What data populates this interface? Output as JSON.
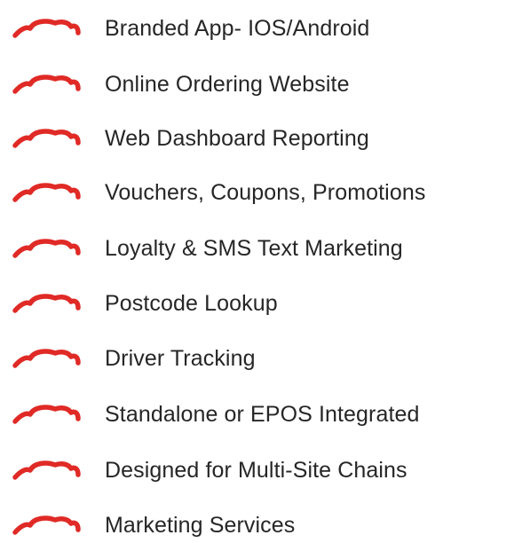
{
  "accent_color": "#e02a26",
  "text_color": "#262626",
  "icon": "red-swoosh-icon",
  "features": [
    "Branded App- IOS/Android",
    "Online Ordering Website",
    "Web Dashboard Reporting",
    "Vouchers, Coupons, Promotions",
    "Loyalty & SMS Text Marketing",
    "Postcode Lookup",
    "Driver Tracking",
    "Standalone or EPOS Integrated",
    "Designed for Multi-Site Chains",
    "Marketing Services"
  ]
}
